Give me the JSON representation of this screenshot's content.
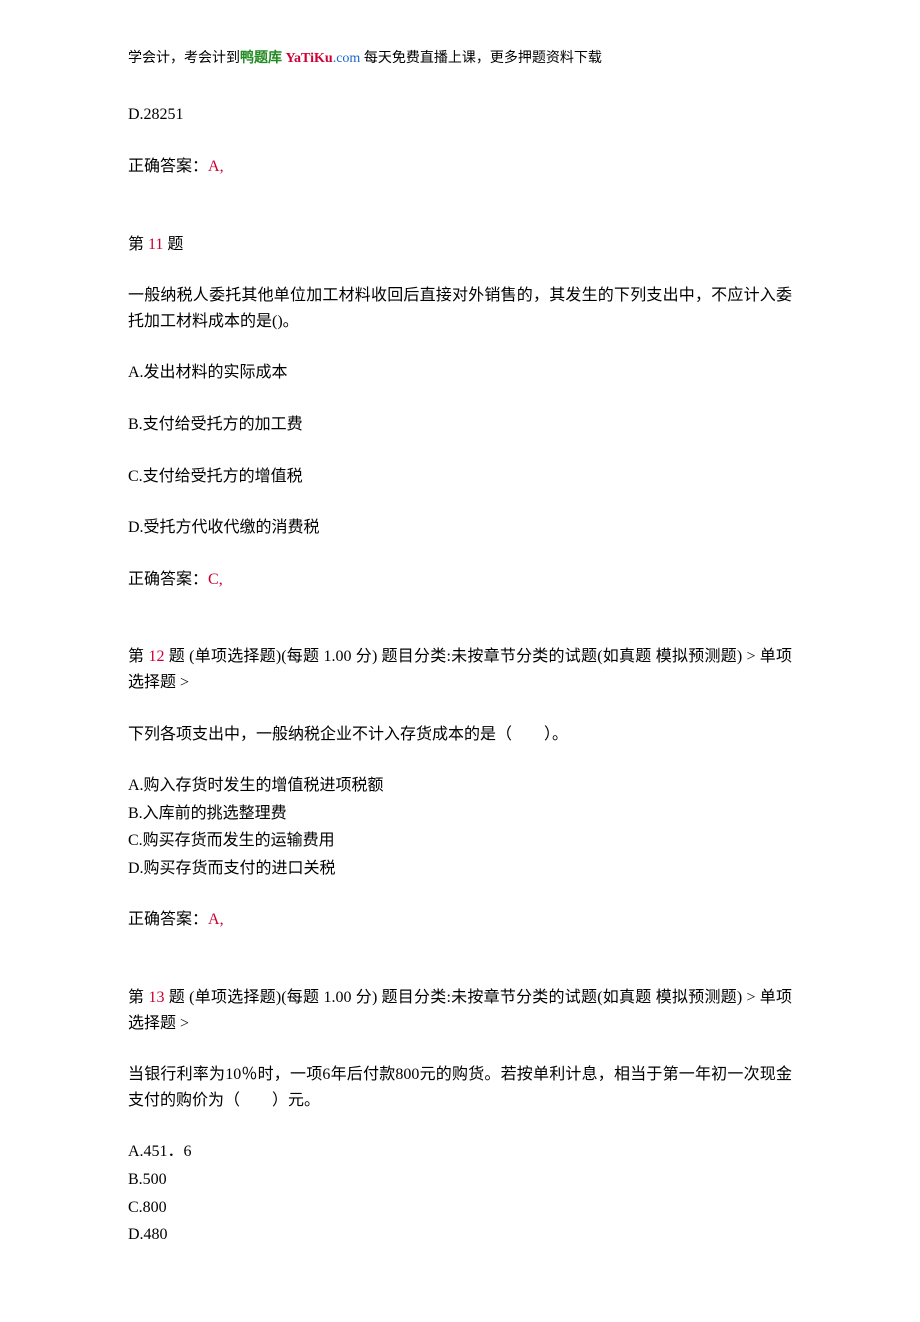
{
  "header": {
    "prefix": "学会计，考会计到",
    "brand_green": "鸭题库",
    "brand_red": " YaTiKu",
    "brand_suffix": ".com",
    "tail": " 每天免费直播上课，更多押题资料下载"
  },
  "q10_remainder": {
    "option_d": "D.28251",
    "answer_label": "正确答案：",
    "answer": "A,"
  },
  "q11": {
    "num_prefix": "第 ",
    "num": "11",
    "num_suffix": " 题",
    "stem": "一般纳税人委托其他单位加工材料收回后直接对外销售的，其发生的下列支出中，不应计入委托加工材料成本的是()。",
    "a": "A.发出材料的实际成本",
    "b": "B.支付给受托方的加工费",
    "c": "C.支付给受托方的增值税",
    "d": "D.受托方代收代缴的消费税",
    "answer_label": "正确答案：",
    "answer": "C,"
  },
  "q12": {
    "num_prefix": "第 ",
    "num": "12",
    "num_suffix": " 题 (单项选择题)(每题 1.00 分) 题目分类:未按章节分类的试题(如真题 模拟预测题) > 单项选择题 >",
    "stem": "下列各项支出中，一般纳税企业不计入存货成本的是（　　）。",
    "a": "A.购入存货时发生的增值税进项税额",
    "b": "B.入库前的挑选整理费",
    "c": "C.购买存货而发生的运输费用",
    "d": "D.购买存货而支付的进口关税",
    "answer_label": "正确答案：",
    "answer": "A,"
  },
  "q13": {
    "num_prefix": "第 ",
    "num": "13",
    "num_suffix": " 题 (单项选择题)(每题 1.00 分) 题目分类:未按章节分类的试题(如真题 模拟预测题) > 单项选择题 >",
    "stem": "当银行利率为10％时，一项6年后付款800元的购货。若按单利计息，相当于第一年初一次现金支付的购价为（　　）元。",
    "a": "A.451．6",
    "b": "B.500",
    "c": "C.800",
    "d": "D.480"
  }
}
